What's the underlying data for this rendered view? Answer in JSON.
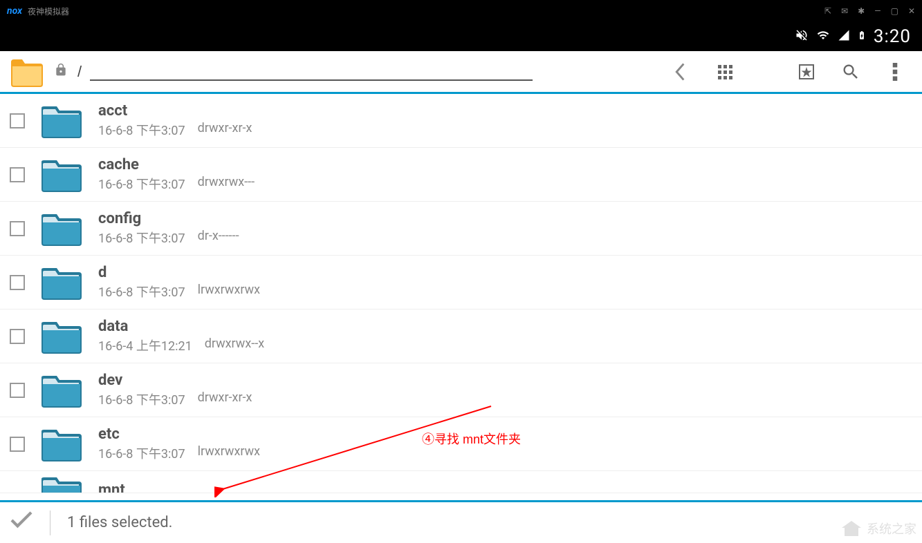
{
  "titlebar": {
    "logo": "nox",
    "title": "夜神模拟器"
  },
  "statusbar": {
    "time": "3:20"
  },
  "toolbar": {
    "path": "/"
  },
  "files": [
    {
      "name": "acct",
      "date": "16-6-8 下午3:07",
      "perm": "drwxr-xr-x"
    },
    {
      "name": "cache",
      "date": "16-6-8 下午3:07",
      "perm": "drwxrwx---"
    },
    {
      "name": "config",
      "date": "16-6-8 下午3:07",
      "perm": "dr-x------"
    },
    {
      "name": "d",
      "date": "16-6-8 下午3:07",
      "perm": "lrwxrwxrwx"
    },
    {
      "name": "data",
      "date": "16-6-4 上午12:21",
      "perm": "drwxrwx--x"
    },
    {
      "name": "dev",
      "date": "16-6-8 下午3:07",
      "perm": "drwxr-xr-x"
    },
    {
      "name": "etc",
      "date": "16-6-8 下午3:07",
      "perm": "lrwxrwxrwx"
    }
  ],
  "partial_file": {
    "name": "mnt"
  },
  "selection": {
    "text": "1 files selected."
  },
  "annotation": {
    "text": "④寻找 mnt文件夹"
  },
  "watermark": {
    "text": "系统之家"
  }
}
